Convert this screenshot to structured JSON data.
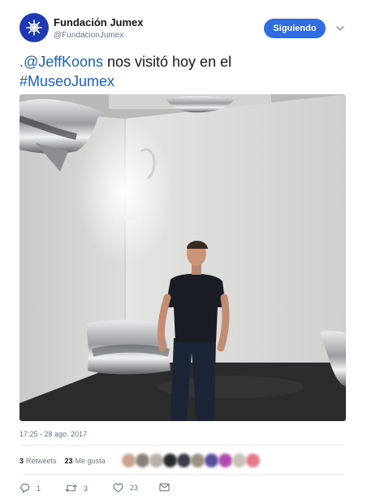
{
  "account": {
    "name": "Fundación Jumex",
    "handle": "@FundacionJumex",
    "avatar_color": "#1f39b4"
  },
  "follow_button": {
    "label": "Siguiendo",
    "color": "#2f6de1"
  },
  "menu_icon": "chevron-down-icon",
  "tweet": {
    "mention": ".@JeffKoons",
    "text_middle": " nos visitó hoy en el",
    "hashtag": "#MuseoJumex",
    "link_color": "#1b5fc0"
  },
  "photo": {
    "subject": "man-in-gallery-with-silver-pillows"
  },
  "timestamp": "17:25 - 28 ago. 2017",
  "stats": {
    "retweets_count": "3",
    "retweets_label": "Retweets",
    "likes_count": "23",
    "likes_label": "Me gusta"
  },
  "liker_avatars": [
    "#c9a38f",
    "#8a7f78",
    "#b8b0a8",
    "#2a2a2a",
    "#3b3b4a",
    "#9a8f7f",
    "#5a4f9a",
    "#b04ab0",
    "#c8c0b8",
    "#e07a86"
  ],
  "actions": {
    "reply_count": "1",
    "retweet_count": "3",
    "like_count": "23"
  }
}
